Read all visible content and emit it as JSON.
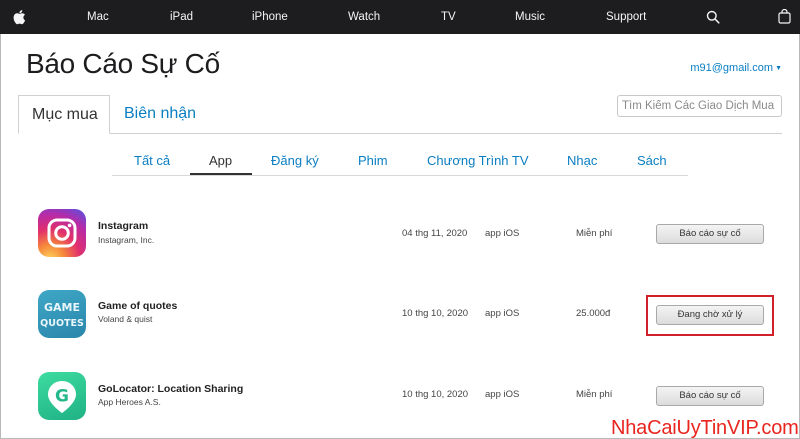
{
  "nav": {
    "items": [
      "Mac",
      "iPad",
      "iPhone",
      "Watch",
      "TV",
      "Music",
      "Support"
    ]
  },
  "header": {
    "title": "Báo Cáo Sự Cố",
    "account": "m91@gmail.com"
  },
  "main_tabs": [
    {
      "label": "Mục mua",
      "active": true
    },
    {
      "label": "Biên nhận",
      "active": false
    }
  ],
  "search": {
    "placeholder": "Tìm Kiếm Các Giao Dịch Mua H"
  },
  "sub_tabs": [
    {
      "label": "Tất cả",
      "active": false
    },
    {
      "label": "App",
      "active": true
    },
    {
      "label": "Đăng ký",
      "active": false
    },
    {
      "label": "Phim",
      "active": false
    },
    {
      "label": "Chương Trình TV",
      "active": false
    },
    {
      "label": "Nhạc",
      "active": false
    },
    {
      "label": "Sách",
      "active": false
    }
  ],
  "purchases": [
    {
      "name": "Instagram",
      "developer": "Instagram, Inc.",
      "date": "04 thg 11, 2020",
      "type": "app iOS",
      "price": "Miễn phí",
      "action": "Báo cáo sự cố",
      "icon": "instagram-icon"
    },
    {
      "name": "Game of quotes",
      "developer": "Voland & quist",
      "date": "10 thg 10, 2020",
      "type": "app iOS",
      "price": "25.000đ",
      "action": "Đang chờ xử lý",
      "icon": "game-of-quotes-icon",
      "icon_text": [
        "GAME",
        "QUOTES"
      ]
    },
    {
      "name": "GoLocator: Location Sharing",
      "developer": "App Heroes A.S.",
      "date": "10 thg 10, 2020",
      "type": "app iOS",
      "price": "Miễn phí",
      "action": "Báo cáo sự cố",
      "icon": "golocator-icon",
      "icon_text": [
        "G"
      ]
    }
  ],
  "watermark": "NhaCaiUyTinVIP.com",
  "colors": {
    "nav_bg": "#1d1d1f",
    "link": "#0a7ec2",
    "highlight": "#d0212b",
    "watermark": "#e8261f"
  }
}
